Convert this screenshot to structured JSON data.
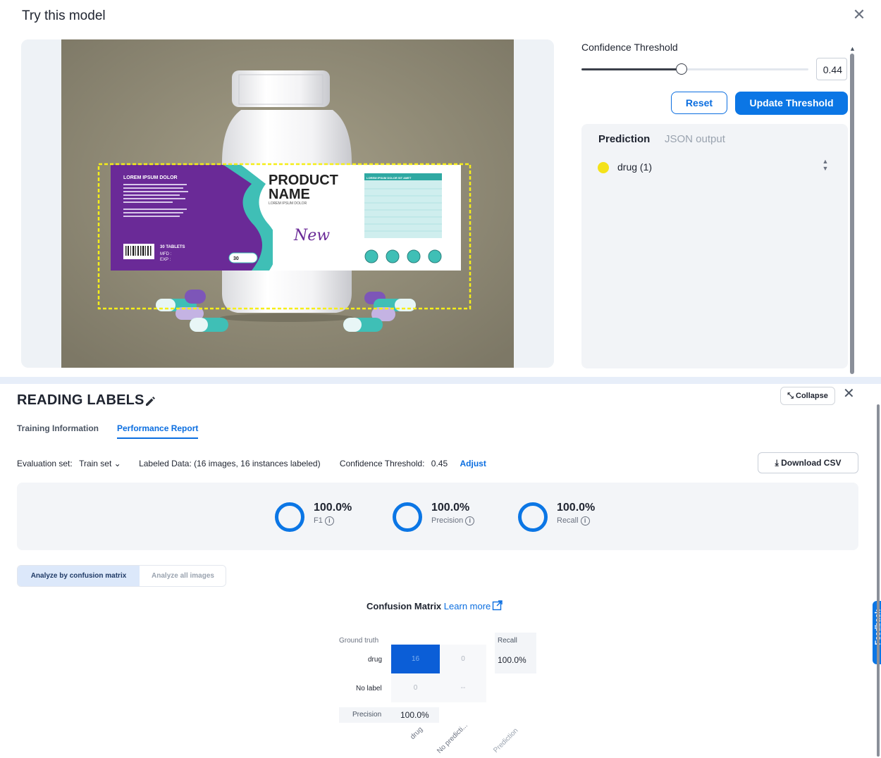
{
  "modal": {
    "title": "Try this model",
    "close_icon": "close-icon",
    "confidence_label": "Confidence Threshold",
    "confidence_value": "0.44",
    "slider_fraction": 0.44,
    "reset_label": "Reset",
    "update_label": "Update Threshold",
    "tabs": {
      "prediction": "Prediction",
      "json": "JSON output"
    },
    "prediction_item": {
      "label": "drug (1)",
      "color": "#f4e21a"
    }
  },
  "product_image": {
    "label_heading": "LOREM IPSUM DOLOR",
    "product_line1": "PRODUCT",
    "product_line2": "NAME",
    "product_sub": "LOREM IPSUM DOLOR",
    "script_word": "New",
    "tablets_label": "30 TABLETS",
    "mfd": "MFD :",
    "exp": "EXP :",
    "pill_badge": "30",
    "facts_header": "LOREM IPSUM DOLOR SIT AMET",
    "box_color": "#f5ee19",
    "purple": "#6a2a97",
    "teal": "#3fbfb6"
  },
  "report": {
    "title": "READING LABELS",
    "collapse_label": "Collapse",
    "tabs": {
      "training": "Training Information",
      "performance": "Performance Report"
    },
    "eval_label": "Evaluation set:",
    "eval_value": "Train set",
    "labeled_data": "Labeled Data: (16 images, 16 instances labeled)",
    "threshold_label": "Confidence Threshold:",
    "threshold_value": "0.45",
    "adjust_label": "Adjust",
    "download_label": "Download CSV",
    "metrics": [
      {
        "value": "100.0%",
        "label": "F1"
      },
      {
        "value": "100.0%",
        "label": "Precision"
      },
      {
        "value": "100.0%",
        "label": "Recall"
      }
    ],
    "analyze": {
      "matrix": "Analyze by confusion matrix",
      "all": "Analyze all images"
    },
    "confusion": {
      "title": "Confusion Matrix",
      "learn_more": "Learn more",
      "ground_truth": "Ground truth",
      "rows": [
        "drug",
        "No label"
      ],
      "cells": [
        [
          "16",
          "0"
        ],
        [
          "0",
          "--"
        ]
      ],
      "recall_head": "Recall",
      "recall_value": "100.0%",
      "precision_head": "Precision",
      "precision_value": "100.0%",
      "cols": [
        "drug",
        "No predicti...",
        "Prediction"
      ]
    },
    "feedback_label": "Feedback"
  }
}
